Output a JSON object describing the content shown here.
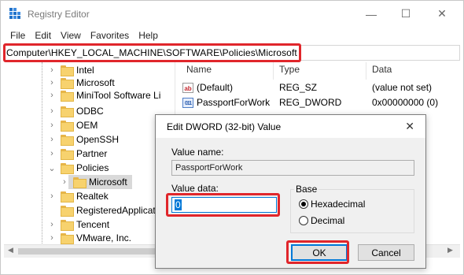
{
  "window": {
    "title": "Registry Editor",
    "menu": [
      "File",
      "Edit",
      "View",
      "Favorites",
      "Help"
    ],
    "controls": {
      "minimize": "—",
      "maximize": "☐",
      "close": "✕"
    }
  },
  "address": "Computer\\HKEY_LOCAL_MACHINE\\SOFTWARE\\Policies\\Microsoft",
  "tree": {
    "items": [
      {
        "label": "Intel",
        "chevron": "›"
      },
      {
        "label": "Microsoft",
        "chevron": "›"
      },
      {
        "label": "MiniTool Software Li",
        "chevron": "›"
      },
      {
        "label": "ODBC",
        "chevron": "›"
      },
      {
        "label": "OEM",
        "chevron": "›"
      },
      {
        "label": "OpenSSH",
        "chevron": "›"
      },
      {
        "label": "Partner",
        "chevron": "›"
      },
      {
        "label": "Policies",
        "chevron": "⌄"
      },
      {
        "label": "Microsoft",
        "chevron": "›"
      },
      {
        "label": "Realtek",
        "chevron": "›"
      },
      {
        "label": "RegisteredApplicatic",
        "chevron": ""
      },
      {
        "label": "Tencent",
        "chevron": "›"
      },
      {
        "label": "VMware, Inc.",
        "chevron": "›"
      }
    ]
  },
  "list": {
    "headers": {
      "name": "Name",
      "type": "Type",
      "data": "Data"
    },
    "rows": [
      {
        "icon": "ab",
        "name": "(Default)",
        "type": "REG_SZ",
        "data": "(value not set)"
      },
      {
        "icon": "011",
        "name": "PassportForWork",
        "type": "REG_DWORD",
        "data": "0x00000000 (0)"
      }
    ]
  },
  "dialog": {
    "title": "Edit DWORD (32-bit) Value",
    "close": "✕",
    "value_name_label": "Value name:",
    "value_name": "PassportForWork",
    "value_data_label": "Value data:",
    "value_data": "0",
    "base_label": "Base",
    "base_options": [
      "Hexadecimal",
      "Decimal"
    ],
    "base_selected": "Hexadecimal",
    "ok": "OK",
    "cancel": "Cancel"
  },
  "colors": {
    "highlight": "#e0262b",
    "accent": "#0078d7"
  }
}
